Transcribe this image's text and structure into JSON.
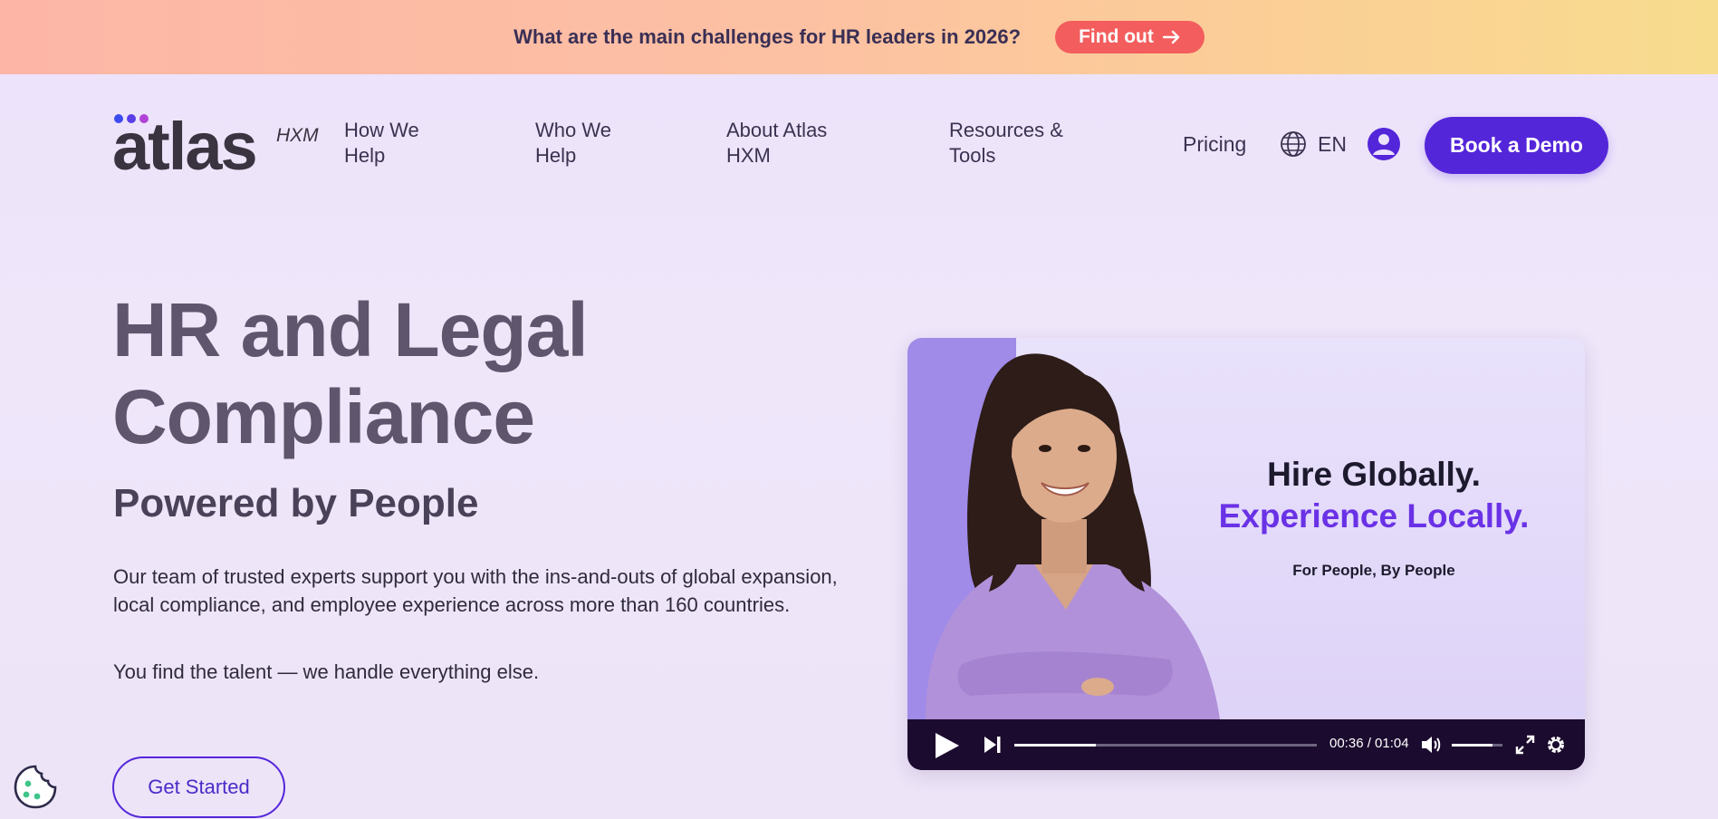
{
  "banner": {
    "text": "What are the main challenges for HR leaders in 2026?",
    "button_label": "Find out"
  },
  "logo": {
    "word": "atlas",
    "sub": "HXM",
    "dot_colors": [
      "#3c4bf0",
      "#5a3ee8",
      "#b143d8"
    ]
  },
  "nav": {
    "items": [
      {
        "line1": "How We",
        "line2": "Help"
      },
      {
        "line1": "Who We",
        "line2": "Help"
      },
      {
        "line1": "About Atlas",
        "line2": "HXM"
      },
      {
        "line1": "Resources &",
        "line2": "Tools"
      }
    ],
    "pricing": "Pricing",
    "language": "EN",
    "demo_button": "Book a Demo"
  },
  "hero": {
    "title_line1": "HR and Legal",
    "title_line2": "Compliance",
    "subtitle": "Powered by People",
    "paragraph1": "Our team of trusted experts support you with the ins-and-outs of global expansion, local compliance, and employee experience across more than 160 countries.",
    "paragraph2": "You find the talent — we handle everything else.",
    "cta": "Get Started"
  },
  "video": {
    "headline1": "Hire Globally.",
    "headline2": "Experience Locally.",
    "tagline": "For People, By People",
    "time_display": "00:36 / 01:04",
    "progress": 0.27,
    "volume": 0.8
  },
  "colors": {
    "accent": "#5426d9",
    "banner_button": "#f35d5d",
    "video_controls": "#1b0b2e"
  }
}
